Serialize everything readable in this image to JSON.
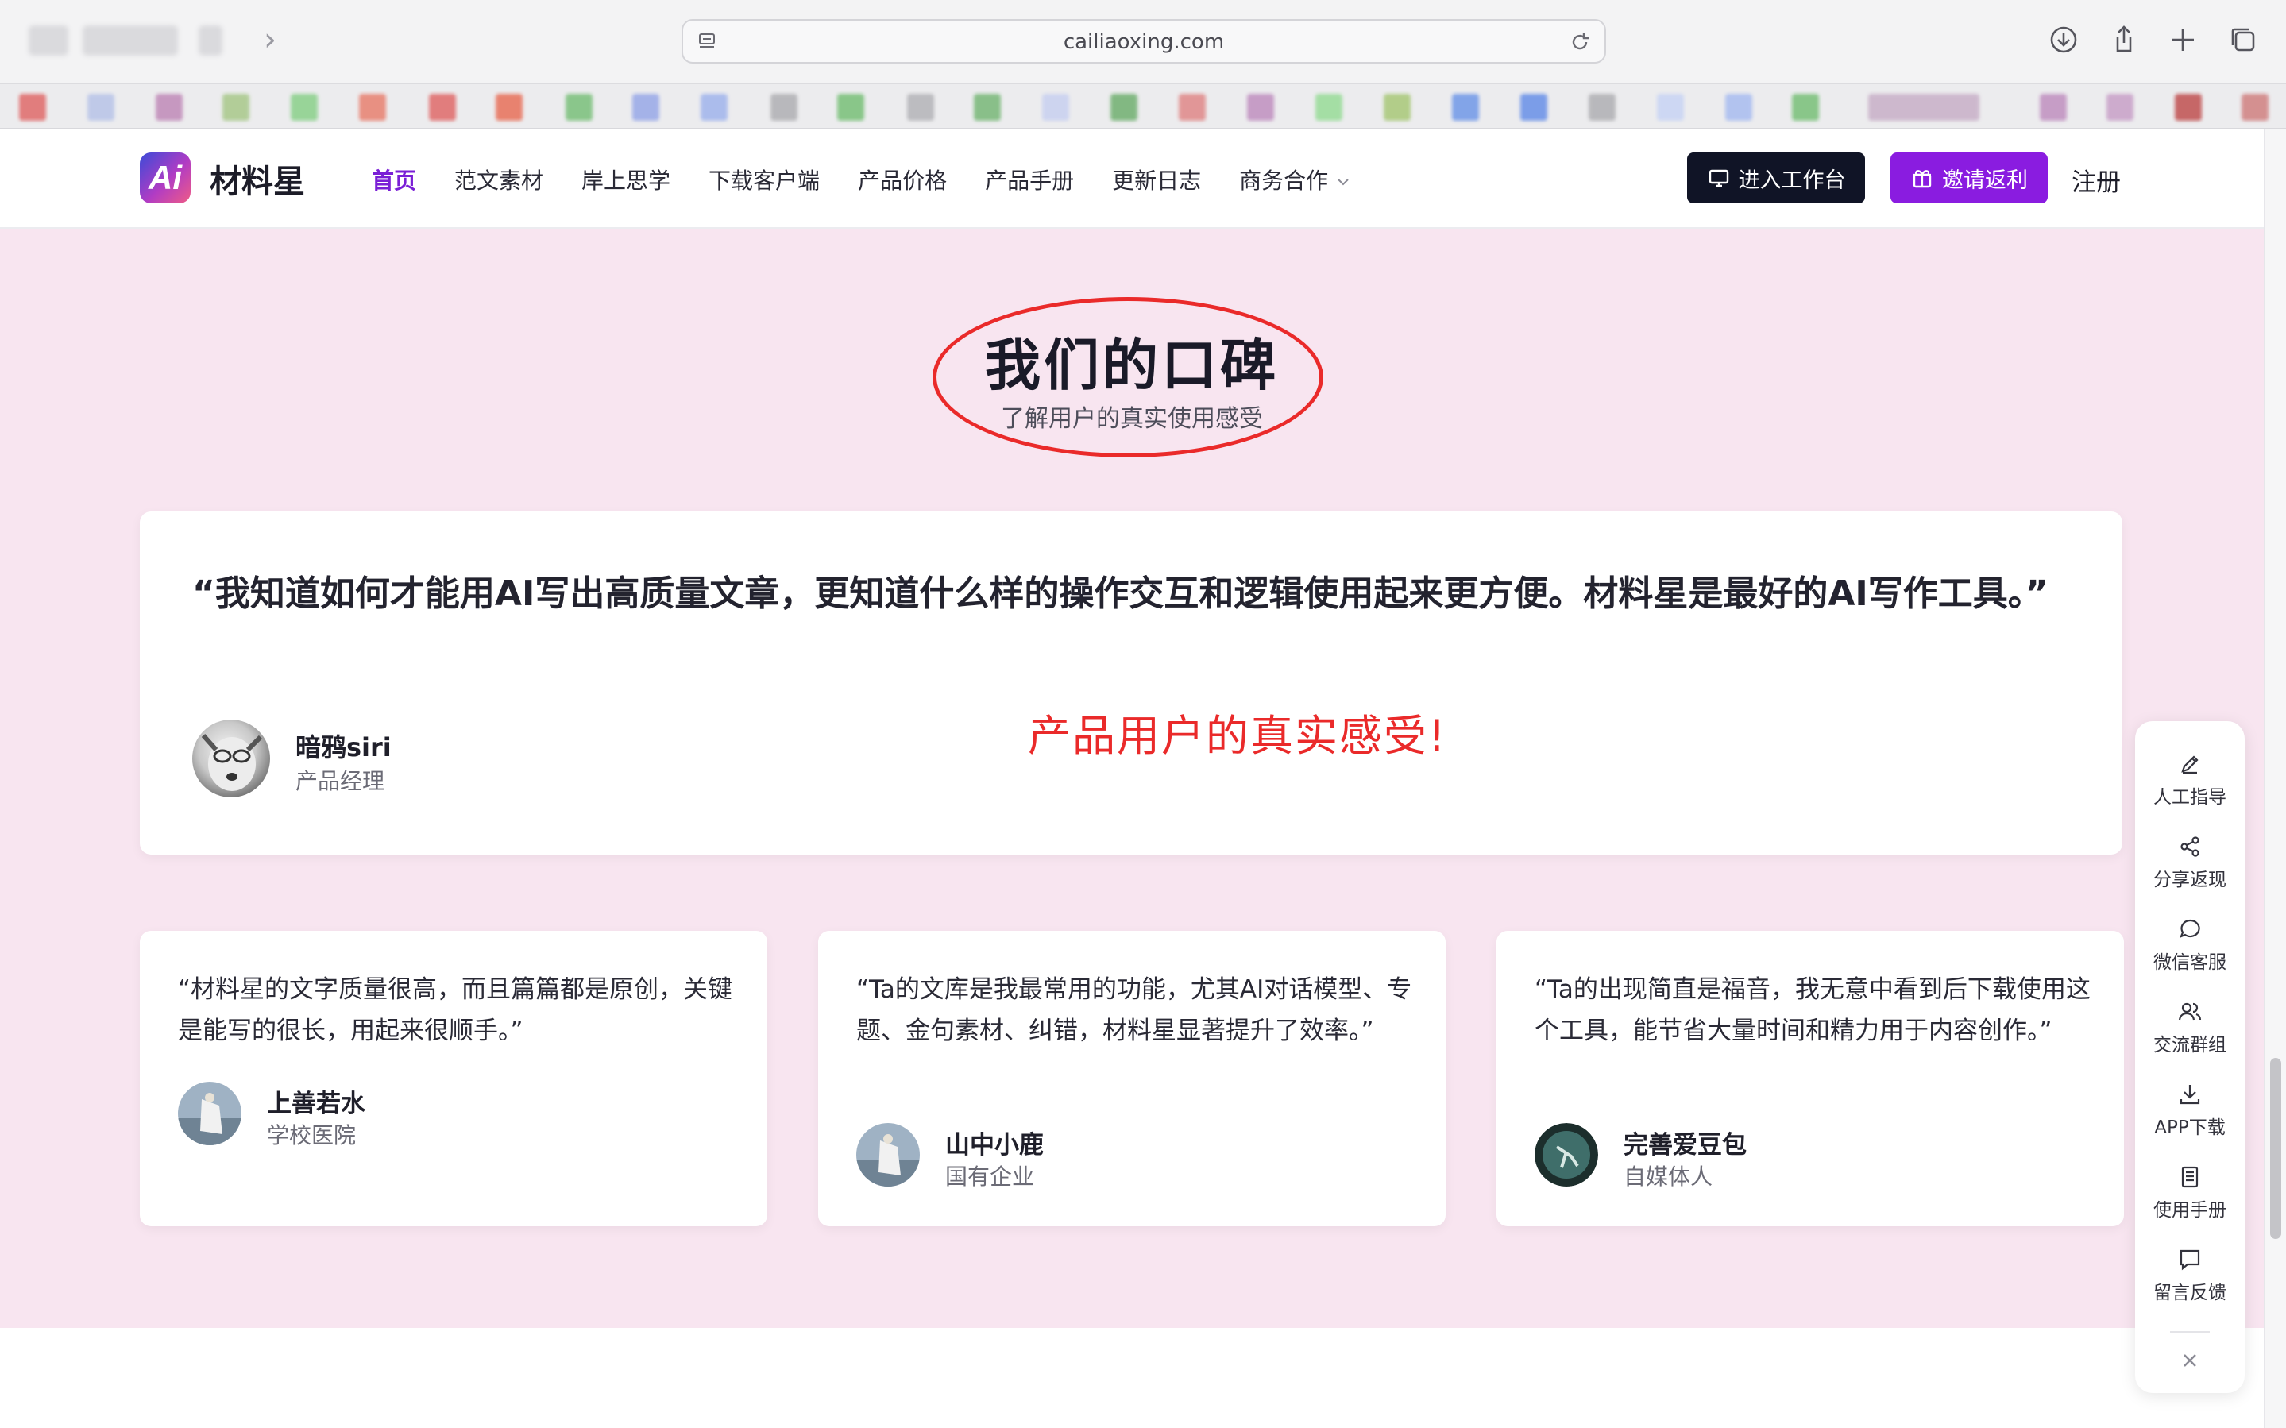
{
  "browser": {
    "url": "cailiaoxing.com"
  },
  "header": {
    "logo_text": "Ai",
    "brand": "材料星",
    "nav": [
      {
        "label": "首页",
        "active": true
      },
      {
        "label": "范文素材"
      },
      {
        "label": "岸上思学"
      },
      {
        "label": "下载客户端"
      },
      {
        "label": "产品价格"
      },
      {
        "label": "产品手册"
      },
      {
        "label": "更新日志"
      },
      {
        "label": "商务合作",
        "has_dropdown": true
      }
    ],
    "workbench_button": "进入工作台",
    "invite_button": "邀请返利",
    "register": "注册"
  },
  "section": {
    "title": "我们的口碑",
    "subtitle": "了解用户的真实使用感受",
    "annotation": "产品用户的真实感受!"
  },
  "featured": {
    "quote": "“我知道如何才能用AI写出高质量文章，更知道什么样的操作交互和逻辑使用起来更方便。材料星是最好的AI写作工具。”",
    "name": "暗鸦siri",
    "role": "产品经理"
  },
  "testimonials": [
    {
      "quote": "“材料星的文字质量很高，而且篇篇都是原创，关键是能写的很长，用起来很顺手。”",
      "name": "上善若水",
      "role": "学校医院"
    },
    {
      "quote": "“Ta的文库是我最常用的功能，尤其AI对话模型、专题、金句素材、纠错，材料星显著提升了效率。”",
      "name": "山中小鹿",
      "role": "国有企业"
    },
    {
      "quote": "“Ta的出现简直是福音，我无意中看到后下载使用这个工具，能节省大量时间和精力用于内容创作。”",
      "name": "完善爱豆包",
      "role": "自媒体人"
    }
  ],
  "sidebar": {
    "items": [
      {
        "label": "人工指导",
        "icon": "pen-icon"
      },
      {
        "label": "分享返现",
        "icon": "share-icon"
      },
      {
        "label": "微信客服",
        "icon": "chat-bubble-icon"
      },
      {
        "label": "交流群组",
        "icon": "users-icon"
      },
      {
        "label": "APP下载",
        "icon": "download-icon"
      },
      {
        "label": "使用手册",
        "icon": "book-icon"
      },
      {
        "label": "留言反馈",
        "icon": "message-icon"
      }
    ]
  },
  "colors": {
    "accent": "#8a1ce0",
    "section_bg": "#f8e5f0",
    "annotation_red": "#ea2a2a",
    "dark_button": "#101426"
  }
}
